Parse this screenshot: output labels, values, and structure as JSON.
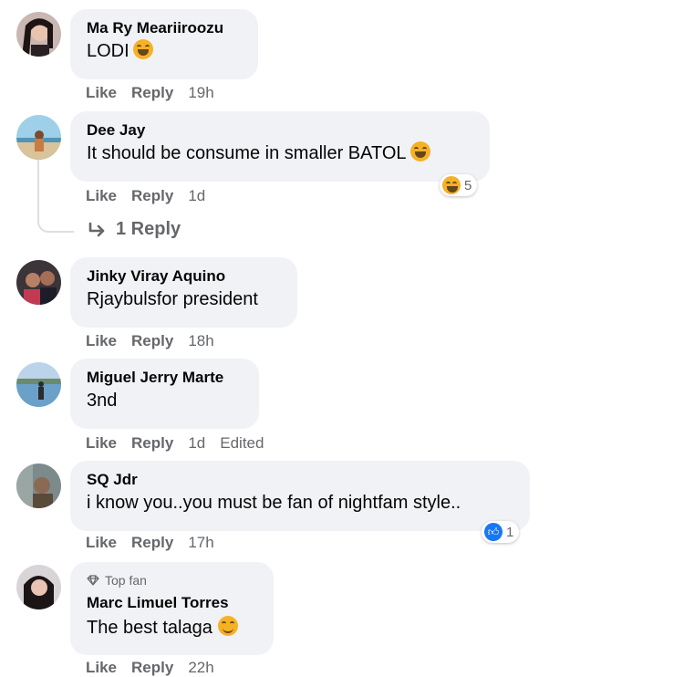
{
  "comments": [
    {
      "name": "Ma Ry Meariiroozu",
      "text": "LODI",
      "emoji": "laughing-tears-emoji",
      "like": "Like",
      "reply": "Reply",
      "time": "19h"
    },
    {
      "name": "Dee Jay",
      "text": "It should be consume in smaller BATOL",
      "emoji": "laughing-tears-emoji",
      "like": "Like",
      "reply": "Reply",
      "time": "1d",
      "reaction_count": "5",
      "replies_label": "1 Reply"
    },
    {
      "name": "Jinky Viray Aquino",
      "text": "Rjaybulsfor president",
      "like": "Like",
      "reply": "Reply",
      "time": "18h"
    },
    {
      "name": "Miguel Jerry Marte",
      "text": "3nd",
      "like": "Like",
      "reply": "Reply",
      "time": "1d",
      "edited": "Edited"
    },
    {
      "name": "SQ Jdr",
      "text": "i know you..you must be fan of nightfam style..",
      "like": "Like",
      "reply": "Reply",
      "time": "17h",
      "reaction_count": "1"
    },
    {
      "badge": "Top fan",
      "name": "Marc Limuel Torres",
      "text": "The best talaga",
      "emoji": "smiling-emoji",
      "like": "Like",
      "reply": "Reply",
      "time": "22h"
    }
  ],
  "colors": {
    "bubble": "#f0f2f5",
    "meta": "#65676b",
    "like_blue": "#1877f2",
    "emoji": "#f7b125"
  }
}
